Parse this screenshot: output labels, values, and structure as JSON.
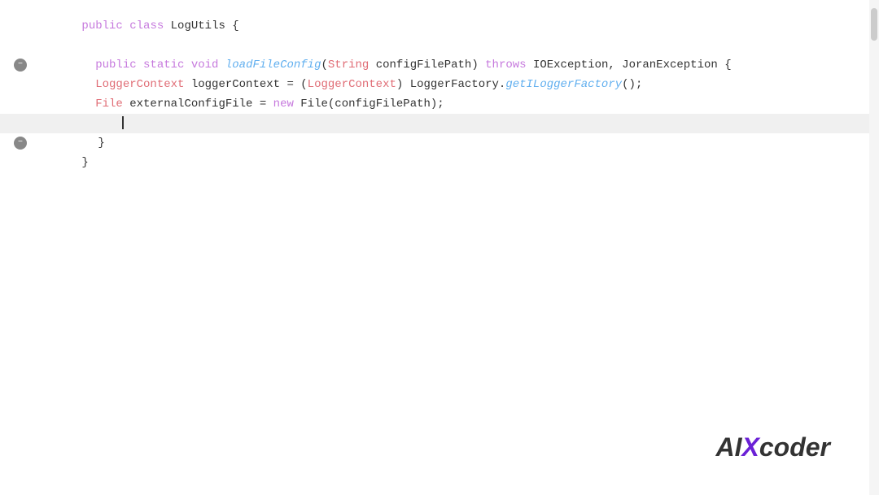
{
  "editor": {
    "lines": [
      {
        "id": "line1",
        "indent": 0,
        "gutter": "",
        "highlighted": false,
        "tokens": [
          {
            "type": "kw",
            "text": "public "
          },
          {
            "type": "kw",
            "text": "class "
          },
          {
            "type": "plain",
            "text": "LogUtils {"
          }
        ]
      },
      {
        "id": "line2",
        "indent": 0,
        "gutter": "",
        "highlighted": false,
        "tokens": [
          {
            "type": "plain",
            "text": ""
          }
        ]
      },
      {
        "id": "line3",
        "indent": 1,
        "gutter": "collapse",
        "highlighted": false,
        "tokens": [
          {
            "type": "kw",
            "text": "public "
          },
          {
            "type": "kw",
            "text": "static "
          },
          {
            "type": "kw",
            "text": "void "
          },
          {
            "type": "method",
            "text": "loadFileConfig"
          },
          {
            "type": "plain",
            "text": "("
          },
          {
            "type": "type",
            "text": "String"
          },
          {
            "type": "plain",
            "text": " configFilePath) "
          },
          {
            "type": "throws-kw",
            "text": "throws "
          },
          {
            "type": "plain",
            "text": "IOException, JoranException {"
          }
        ]
      },
      {
        "id": "line4",
        "indent": 2,
        "gutter": "",
        "highlighted": false,
        "tokens": [
          {
            "type": "type",
            "text": "LoggerContext"
          },
          {
            "type": "plain",
            "text": " loggerContext = ("
          },
          {
            "type": "cast",
            "text": "LoggerContext"
          },
          {
            "type": "plain",
            "text": ") "
          },
          {
            "type": "plain",
            "text": "LoggerFactory."
          },
          {
            "type": "method",
            "text": "getILoggerFactory"
          },
          {
            "type": "plain",
            "text": "();"
          }
        ]
      },
      {
        "id": "line5",
        "indent": 2,
        "gutter": "",
        "highlighted": false,
        "tokens": [
          {
            "type": "type",
            "text": "File"
          },
          {
            "type": "plain",
            "text": " externalConfigFile = "
          },
          {
            "type": "kw",
            "text": "new "
          },
          {
            "type": "plain",
            "text": "File(configFilePath);"
          }
        ]
      },
      {
        "id": "line6",
        "indent": 2,
        "gutter": "",
        "highlighted": true,
        "tokens": [
          {
            "type": "cursor",
            "text": ""
          }
        ]
      },
      {
        "id": "line7",
        "indent": 1,
        "gutter": "collapse",
        "highlighted": false,
        "tokens": [
          {
            "type": "plain",
            "text": "}"
          }
        ]
      },
      {
        "id": "line8",
        "indent": 0,
        "gutter": "",
        "highlighted": false,
        "tokens": [
          {
            "type": "plain",
            "text": "}"
          }
        ]
      }
    ]
  },
  "logo": {
    "ai": "AI",
    "x": "X",
    "coder": "coder"
  }
}
